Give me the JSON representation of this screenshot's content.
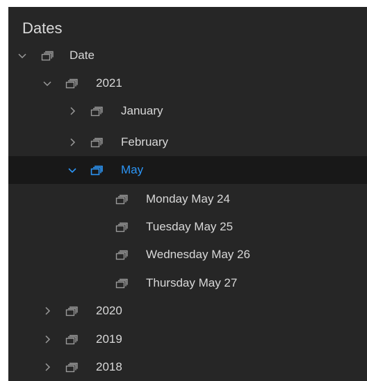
{
  "panel": {
    "title": "Dates"
  },
  "colors": {
    "background": "#262626",
    "selected_background": "#181818",
    "text": "#d8d8d8",
    "icon": "#9a9a9a",
    "accent": "#2c95f5"
  },
  "tree": {
    "root": {
      "label": "Date",
      "state": "expanded",
      "icon": "stack-icon"
    },
    "year_2021": {
      "label": "2021",
      "state": "expanded",
      "icon": "stack-icon"
    },
    "month_january": {
      "label": "January",
      "state": "collapsed",
      "icon": "stack-icon"
    },
    "month_february": {
      "label": "February",
      "state": "collapsed",
      "icon": "stack-icon"
    },
    "month_may": {
      "label": "May",
      "state": "expanded",
      "selected": true,
      "icon": "stack-icon"
    },
    "day_24": {
      "label": "Monday May 24",
      "icon": "stack-icon"
    },
    "day_25": {
      "label": "Tuesday May 25",
      "icon": "stack-icon"
    },
    "day_26": {
      "label": "Wednesday May 26",
      "icon": "stack-icon"
    },
    "day_27": {
      "label": "Thursday May 27",
      "icon": "stack-icon"
    },
    "year_2020": {
      "label": "2020",
      "state": "collapsed",
      "icon": "stack-icon"
    },
    "year_2019": {
      "label": "2019",
      "state": "collapsed",
      "icon": "stack-icon"
    },
    "year_2018": {
      "label": "2018",
      "state": "collapsed",
      "icon": "stack-icon"
    }
  }
}
